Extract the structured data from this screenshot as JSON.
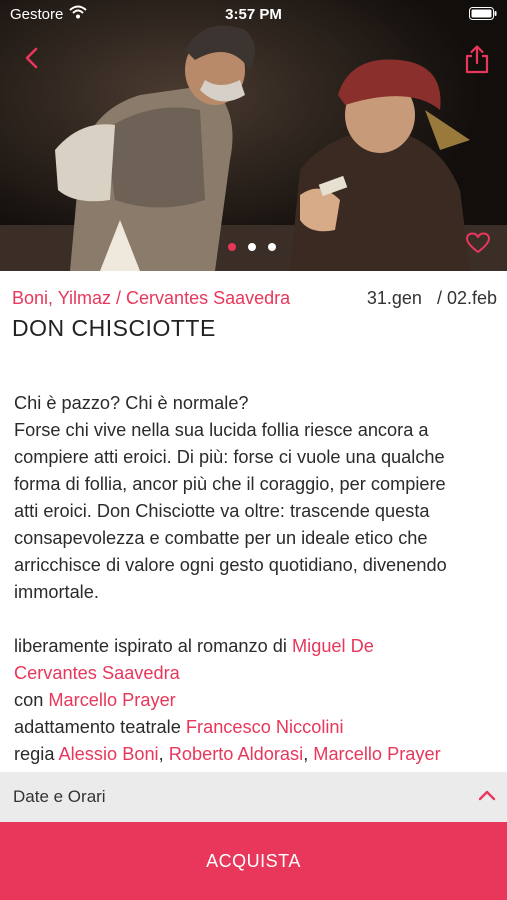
{
  "status_bar": {
    "carrier": "Gestore",
    "time": "3:57 PM"
  },
  "hero": {
    "image_subject": "stage photo: knight in armour facing man in red hat",
    "slides_total": 3,
    "active_slide": 1,
    "icons": [
      "back-chevron-icon",
      "share-icon",
      "heart-icon"
    ]
  },
  "show": {
    "authors": "Boni, Yilmaz / Cervantes Saavedra",
    "date_start": "31.gen",
    "date_end": "/ 02.feb",
    "title": "DON CHISCIOTTE"
  },
  "description": [
    "Chi è pazzo? Chi è normale?",
    "Forse chi vive nella sua lucida follia riesce ancora a",
    "compiere atti eroici. Di più: forse ci vuole una qualche",
    "forma di follia, ancor più che il coraggio, per compiere",
    "atti eroici. Don Chisciotte va oltre: trascende questa",
    "consapevolezza e combatte per un ideale etico che",
    "arricchisce di valore ogni gesto quotidiano, divenendo",
    "immortale."
  ],
  "credits": {
    "inspired_prefix": "liberamente ispirato al romanzo di",
    "inspired_name_1": "Miguel De",
    "inspired_name_2": "Cervantes Saavedra",
    "con_prefix": "con",
    "con_name": "Marcello Prayer",
    "adapt_prefix": "adattamento teatrale",
    "adapt_name": "Francesco Niccolini",
    "regia_prefix": "regia",
    "regia_names": [
      "Alessio Boni",
      "Roberto Aldorasi",
      "Marcello Prayer"
    ]
  },
  "bottom": {
    "dates_label": "Date e Orari",
    "buy_label": "ACQUISTA"
  },
  "colors": {
    "accent": "#e8375b",
    "bar_bg": "#ebebeb"
  }
}
